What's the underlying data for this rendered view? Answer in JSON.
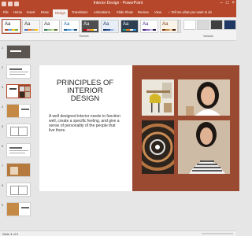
{
  "window": {
    "title": "Interior Design - PowerPoint"
  },
  "tabs": [
    {
      "label": "File"
    },
    {
      "label": "Home"
    },
    {
      "label": "Insert"
    },
    {
      "label": "Draw"
    },
    {
      "label": "Design"
    },
    {
      "label": "Transitions"
    },
    {
      "label": "Animations"
    },
    {
      "label": "Slide Show"
    },
    {
      "label": "Review"
    },
    {
      "label": "View"
    }
  ],
  "tell_me": {
    "placeholder": "Tell me what you want to do"
  },
  "ribbon": {
    "themes_label": "Themes",
    "theme_sample_text": "Aa",
    "variants_label": "Variants",
    "themes": [
      {
        "name": "theme-1",
        "bg": "#ffffff",
        "text": "#222222",
        "bars": [
          "#b7472a",
          "#5b9bd5",
          "#ffc000",
          "#70ad47"
        ]
      },
      {
        "name": "theme-2",
        "bg": "#f5f5f5",
        "text": "#333333",
        "bars": [
          "#4472c4",
          "#ed7d31",
          "#a5a5a5",
          "#ffc000"
        ]
      },
      {
        "name": "theme-3",
        "bg": "#ffffff",
        "text": "#333333",
        "bars": [
          "#3b7a57",
          "#8fbc8f",
          "#c0d890",
          "#556b2f"
        ]
      },
      {
        "name": "theme-4",
        "bg": "#ffffff",
        "text": "#22669a",
        "bars": [
          "#22669a",
          "#5aa0d8",
          "#9bc5e8",
          "#1f4e79"
        ]
      },
      {
        "name": "theme-5",
        "bg": "#4f4f4f",
        "text": "#ffffff",
        "bars": [
          "#c00000",
          "#ff7c80",
          "#ffc000",
          "#ffffff"
        ]
      },
      {
        "name": "theme-6",
        "bg": "#e7eef6",
        "text": "#1f3864",
        "bars": [
          "#1f3864",
          "#2f5597",
          "#8faadc",
          "#dae3f3"
        ]
      },
      {
        "name": "theme-7",
        "bg": "#2c3e50",
        "text": "#ffffff",
        "bars": [
          "#16a085",
          "#e67e22",
          "#ecf0f1",
          "#3498db"
        ]
      },
      {
        "name": "theme-8",
        "bg": "#ffffff",
        "text": "#4b2e83",
        "bars": [
          "#4b2e83",
          "#8e6bbf",
          "#c7b8e0",
          "#2b1a4e"
        ]
      },
      {
        "name": "theme-9",
        "bg": "#faf3e8",
        "text": "#7a3b1e",
        "bars": [
          "#7a3b1e",
          "#c78b4b",
          "#e6c79a",
          "#3e1f0d"
        ]
      }
    ],
    "variants": [
      {
        "color": "#ffffff"
      },
      {
        "color": "#d9d9d9"
      },
      {
        "color": "#404040"
      },
      {
        "color": "#1f3864"
      }
    ]
  },
  "slides_panel": {
    "slides": [
      {
        "number": "1",
        "style": "photo-dark"
      },
      {
        "number": "2",
        "style": "text-light"
      },
      {
        "number": "3",
        "style": "current"
      },
      {
        "number": "4",
        "style": "split-orange"
      },
      {
        "number": "5",
        "style": "plan"
      },
      {
        "number": "6",
        "style": "text-light"
      },
      {
        "number": "7",
        "style": "orange-blocks"
      },
      {
        "number": "8",
        "style": "plan"
      },
      {
        "number": "9",
        "style": "split-orange"
      }
    ]
  },
  "slide": {
    "title": "PRINCIPLES OF INTERIOR DESIGN",
    "body": "A well designed interior needs to function well, create a specific feeling, and give a sense of personality of the people that live there.",
    "accent_color": "#9b4a32"
  },
  "statusbar": {
    "slide_indicator": "Slide 3 of 9"
  },
  "colors": {
    "brand": "#b7472a"
  }
}
